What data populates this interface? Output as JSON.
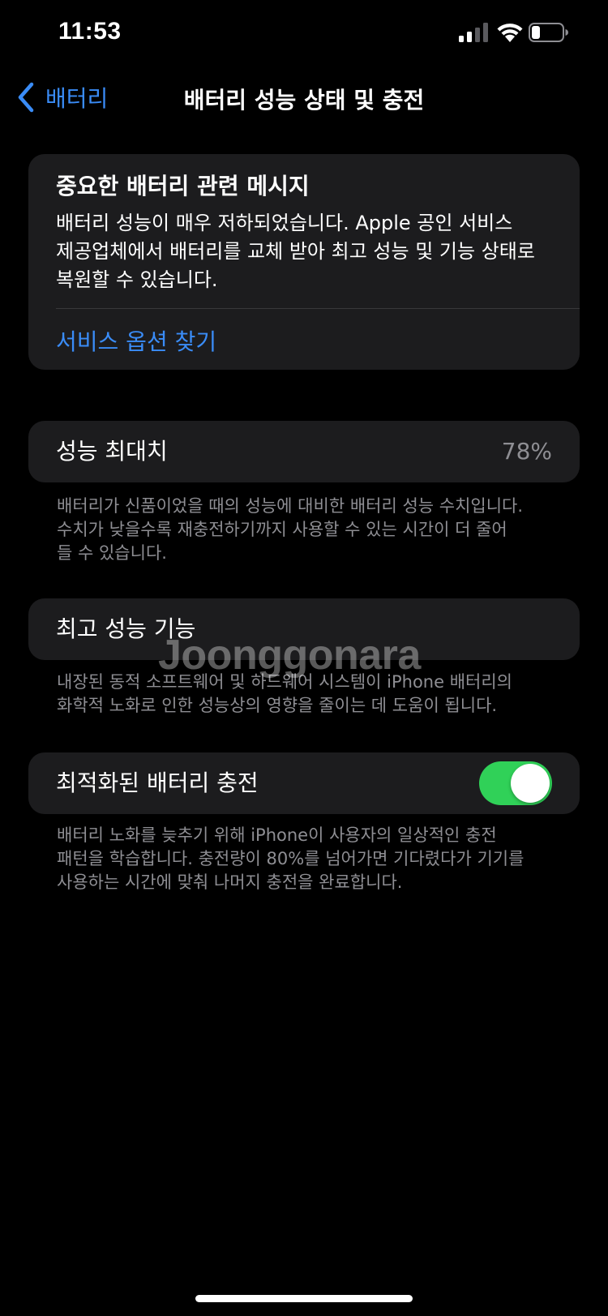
{
  "status_bar": {
    "time": "11:53",
    "icons": [
      "cellular-signal-icon",
      "wifi-icon",
      "battery-icon"
    ]
  },
  "nav": {
    "back_label": "배터리",
    "title": "배터리 성능 상태 및 충전"
  },
  "message_card": {
    "title": "중요한 배터리 관련 메시지",
    "body_lines": [
      "배터리 성능이 매우 저하되었습니다. Apple 공인 서비스",
      "제공업체에서 배터리를 교체 받아 최고 성능 및 기능 상태로",
      "복원할 수 있습니다."
    ],
    "link_label": "서비스 옵션 찾기"
  },
  "maximum_capacity": {
    "label": "성능 최대치",
    "value": "78%",
    "footer_lines": [
      "배터리가 신품이었을 때의 성능에 대비한 배터리 성능 수치입니다.",
      "수치가 낮을수록 재충전하기까지 사용할 수 있는 시간이 더 줄어",
      "들 수 있습니다."
    ]
  },
  "peak_performance": {
    "label": "최고 성능 기능",
    "footer_lines": [
      "내장된 동적 소프트웨어 및 하드웨어 시스템이 iPhone 배터리의",
      "화학적 노화로 인한 성능상의 영향을 줄이는 데 도움이 됩니다."
    ]
  },
  "optimized_charging": {
    "label": "최적화된 배터리 충전",
    "enabled": true,
    "footer_lines": [
      "배터리 노화를 늦추기 위해 iPhone이 사용자의 일상적인 충전",
      "패턴을 학습합니다. 충전량이 80%를 넘어가면 기다렸다가 기기를",
      "사용하는 시간에 맞춰 나머지 충전을 완료합니다."
    ]
  },
  "watermark": "Joonggonara",
  "colors": {
    "background": "#000000",
    "card": "#1c1c1e",
    "accent_blue": "#3a8cf7",
    "toggle_on": "#30d158",
    "secondary_text": "#8e8e93"
  }
}
